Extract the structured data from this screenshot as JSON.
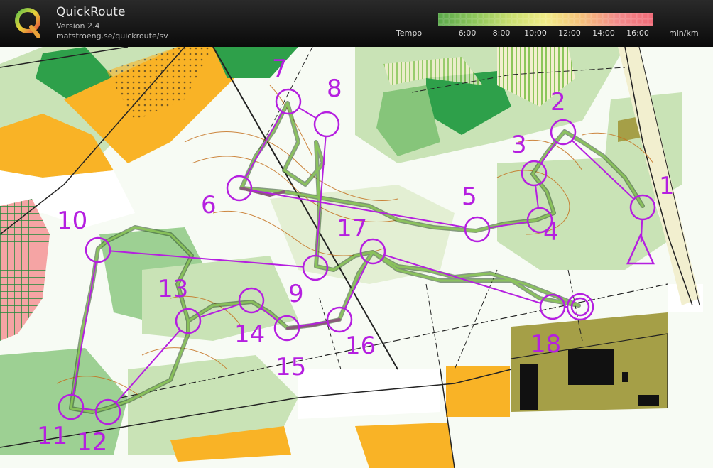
{
  "app": {
    "title": "QuickRoute",
    "version": "Version 2.4",
    "url": "matstroeng.se/quickroute/sv"
  },
  "tempo_scale": {
    "label": "Tempo",
    "ticks": [
      "6:00",
      "8:00",
      "10:00",
      "12:00",
      "14:00",
      "16:00"
    ],
    "unit": "min/km",
    "colors": [
      "#5aa84a",
      "#8cc65a",
      "#c8de6e",
      "#f1ec86",
      "#f6c07a",
      "#f28a8a",
      "#f06a78"
    ]
  },
  "course": {
    "color": "#b51fe0",
    "controls": [
      {
        "number": "1"
      },
      {
        "number": "2"
      },
      {
        "number": "3"
      },
      {
        "number": "4"
      },
      {
        "number": "5"
      },
      {
        "number": "6"
      },
      {
        "number": "7"
      },
      {
        "number": "8"
      },
      {
        "number": "9"
      },
      {
        "number": "10"
      },
      {
        "number": "11"
      },
      {
        "number": "12"
      },
      {
        "number": "13"
      },
      {
        "number": "14"
      },
      {
        "number": "15"
      },
      {
        "number": "16"
      },
      {
        "number": "17"
      },
      {
        "number": "18"
      }
    ]
  },
  "map_colors": {
    "open": "#f9b326",
    "forest": "#ffffff",
    "green_light": "#c9e3b6",
    "green": "#86c57a",
    "green_dark": "#2ea04a",
    "contour": "#c5711f",
    "built": "#a59f47",
    "building": "#111111",
    "route": "#4b6e3a"
  }
}
